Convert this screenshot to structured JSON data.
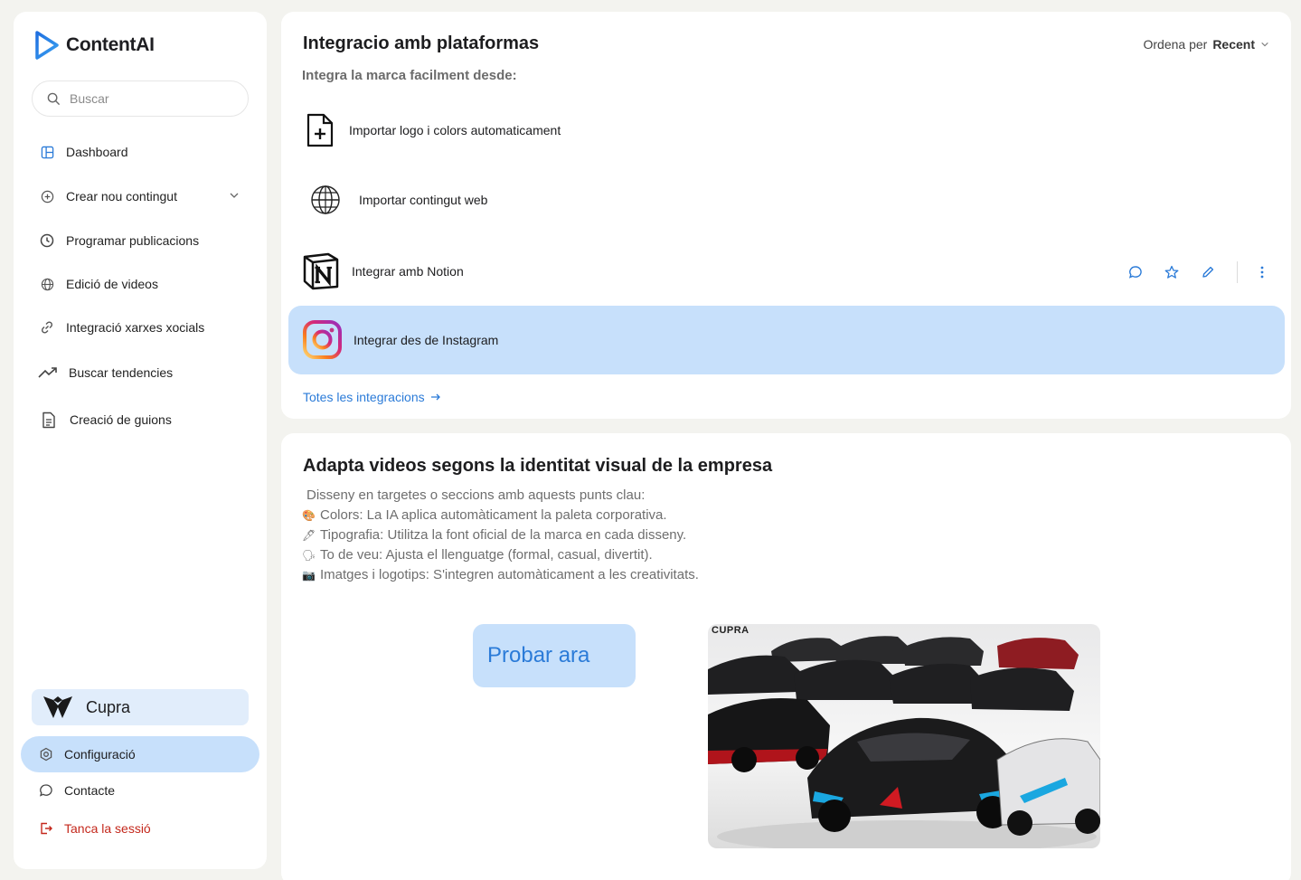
{
  "brand": {
    "name": "ContentAI"
  },
  "search": {
    "placeholder": "Buscar"
  },
  "nav": [
    {
      "label": "Dashboard",
      "icon": "dashboard-icon"
    },
    {
      "label": "Crear nou contingut",
      "icon": "plus-circle-icon"
    },
    {
      "label": "Programar publicacions",
      "icon": "clock-icon"
    },
    {
      "label": "Edició de videos",
      "icon": "globe-icon"
    },
    {
      "label": "Integració xarxes xocials",
      "icon": "link-icon"
    },
    {
      "label": "Buscar tendencies",
      "icon": "trending-icon"
    },
    {
      "label": "Creació de guions",
      "icon": "document-icon"
    }
  ],
  "company": {
    "name": "Cupra"
  },
  "bottom_nav": {
    "config": "Configuració",
    "contact": "Contacte",
    "logout": "Tanca la sessió"
  },
  "integrations": {
    "title": "Integracio amb plataformas",
    "subtitle": "Integra la marca facilment desde:",
    "sort_label": "Ordena per",
    "sort_value": "Recent",
    "items": [
      {
        "label": "Importar logo i colors automaticament",
        "icon": "file-plus-icon"
      },
      {
        "label": "Importar contingut web",
        "icon": "globe-icon"
      },
      {
        "label": "Integrar amb Notion",
        "icon": "notion-icon"
      },
      {
        "label": "Integrar des de Instagram",
        "icon": "instagram-icon"
      }
    ],
    "all_link": "Totes les integracions"
  },
  "adapt": {
    "title": "Adapta videos segons la identitat visual de la empresa",
    "intro": "Disseny en targetes o seccions amb aquests punts clau:",
    "points": [
      {
        "emoji": "🎨",
        "text": "Colors: La IA aplica automàticament la paleta corporativa."
      },
      {
        "emoji": "🖋",
        "text": "Tipografia: Utilitza la font oficial de la marca en cada disseny."
      },
      {
        "emoji": "🗣",
        "text": "To de veu: Ajusta el llenguatge (formal, casual, divertit)."
      },
      {
        "emoji": "📷",
        "text": "Imatges i logotips: S'integren automàticament a les creativitats."
      }
    ],
    "button": "Probar ara",
    "image_logo": "CUPRA"
  },
  "colors": {
    "accent": "#2b7bd8",
    "highlight": "#c7e0fb",
    "logout": "#c4281c"
  }
}
